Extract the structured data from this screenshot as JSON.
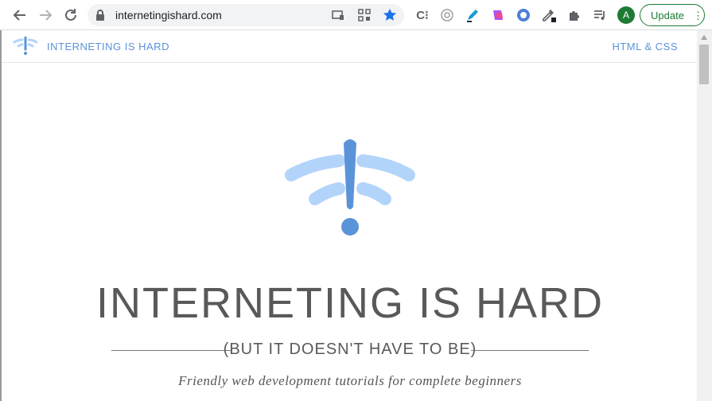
{
  "browser": {
    "url": "internetingishard.com",
    "profile_initial": "A",
    "update_label": "Update",
    "menu_glyph": "⋮"
  },
  "site_nav": {
    "brand": "INTERNETING IS HARD",
    "link": "HTML & CSS"
  },
  "hero": {
    "title": "INTERNETING IS HARD",
    "tagline": "(BUT IT DOESN'T HAVE TO BE)",
    "subtitle": "Friendly web development tutorials for complete beginners"
  },
  "colors": {
    "brand_blue": "#5b93d9",
    "light_blue": "#b3d4fa",
    "title_gray": "#595959",
    "chrome_green": "#1e7b34"
  }
}
